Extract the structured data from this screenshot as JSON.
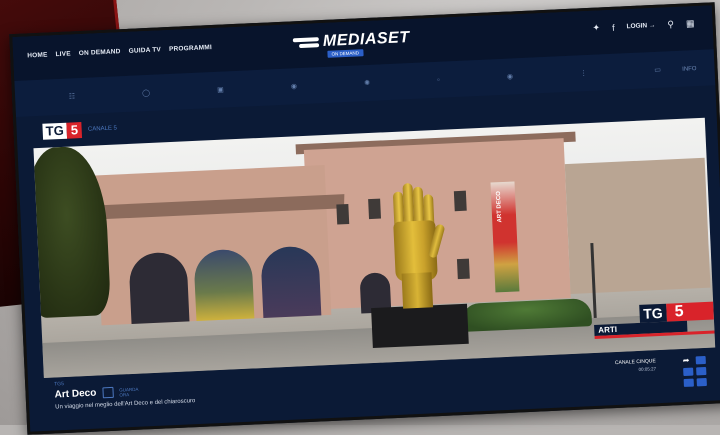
{
  "nav": {
    "items": [
      "HOME",
      "LIVE",
      "ON DEMAND",
      "GUIDA TV",
      "PROGRAMMI"
    ]
  },
  "brand": {
    "name": "MEDIASET",
    "sub": "ON DEMAND"
  },
  "header": {
    "login_label": "LOGIN"
  },
  "info_label": "INFO",
  "channel": {
    "logo_tg": "TG",
    "logo_num": "5",
    "name": "CANALE 5"
  },
  "video_overlay": {
    "tg": "TG",
    "num": "5",
    "section": "ARTI",
    "banner": "ART DECO"
  },
  "program": {
    "kicker": "TG5",
    "title": "Art Deco",
    "tag_line1": "GUARDA",
    "tag_line2": "ORA",
    "subtitle": "Un viaggio nel meglio dell'Art Deco e del chiaroscuro"
  },
  "meta": {
    "channel": "CANALE CINQUE",
    "time": "00:05:27"
  },
  "colors": {
    "accent": "#2b5fc8",
    "brand_red": "#d9232a",
    "bg": "#0b1a36"
  }
}
